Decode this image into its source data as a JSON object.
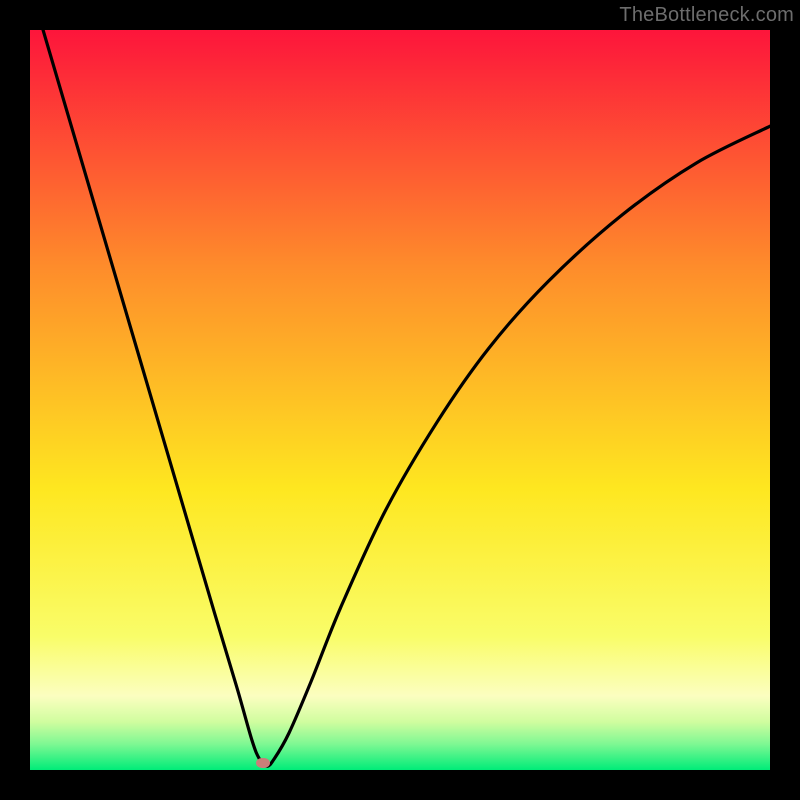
{
  "attribution": "TheBottleneck.com",
  "colors": {
    "bg_frame": "#000000",
    "gradient_top": "#fd153b",
    "gradient_mid1": "#fe8c2b",
    "gradient_mid2": "#fee720",
    "gradient_mid3": "#f9fd69",
    "gradient_band": "#d0fd9f",
    "gradient_bottom": "#00ec79",
    "curve": "#000000",
    "marker": "#c97e79",
    "attribution_text": "#6d6d6d"
  },
  "chart_data": {
    "type": "line",
    "title": "",
    "xlabel": "",
    "ylabel": "",
    "xlim": [
      0,
      1
    ],
    "ylim": [
      0,
      1
    ],
    "series": [
      {
        "name": "bottleneck-curve",
        "x": [
          0.0,
          0.05,
          0.1,
          0.15,
          0.2,
          0.25,
          0.28,
          0.3,
          0.31,
          0.32,
          0.33,
          0.35,
          0.38,
          0.42,
          0.48,
          0.55,
          0.62,
          0.7,
          0.8,
          0.9,
          1.0
        ],
        "y": [
          1.06,
          0.89,
          0.72,
          0.55,
          0.38,
          0.21,
          0.11,
          0.04,
          0.015,
          0.005,
          0.015,
          0.05,
          0.12,
          0.22,
          0.35,
          0.47,
          0.57,
          0.66,
          0.75,
          0.82,
          0.87
        ]
      }
    ],
    "marker": {
      "x": 0.315,
      "y": 0.01
    },
    "gradient_stops": [
      {
        "offset": 0.0,
        "color": "#fd153b"
      },
      {
        "offset": 0.32,
        "color": "#fe8c2b"
      },
      {
        "offset": 0.62,
        "color": "#fee720"
      },
      {
        "offset": 0.82,
        "color": "#f9fd69"
      },
      {
        "offset": 0.9,
        "color": "#fbfec0"
      },
      {
        "offset": 0.935,
        "color": "#d0fd9f"
      },
      {
        "offset": 0.965,
        "color": "#7ef893"
      },
      {
        "offset": 1.0,
        "color": "#00ec79"
      }
    ]
  }
}
